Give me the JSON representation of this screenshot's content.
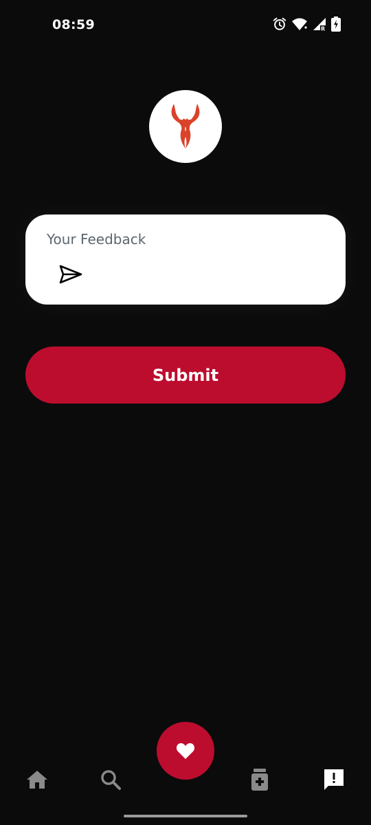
{
  "status_bar": {
    "time": "08:59",
    "icons": [
      "alarm-icon",
      "wifi-icon",
      "signal-icon",
      "battery-charging-icon"
    ]
  },
  "logo": {
    "icon": "bull-horns-logo"
  },
  "feedback": {
    "placeholder": "Your Feedback",
    "value": "",
    "send_icon": "send-icon"
  },
  "submit": {
    "label": "Submit"
  },
  "bottom_nav": {
    "items": [
      {
        "icon": "home-icon"
      },
      {
        "icon": "search-icon"
      },
      {
        "icon": "heart-icon",
        "active": true
      },
      {
        "icon": "medicine-icon"
      },
      {
        "icon": "feedback-icon"
      }
    ]
  },
  "colors": {
    "background": "#0b0b0b",
    "accent": "#bd0d2f",
    "logo": "#d9432a",
    "label": "#5c6670",
    "nav_inactive": "#8a8a8a"
  }
}
